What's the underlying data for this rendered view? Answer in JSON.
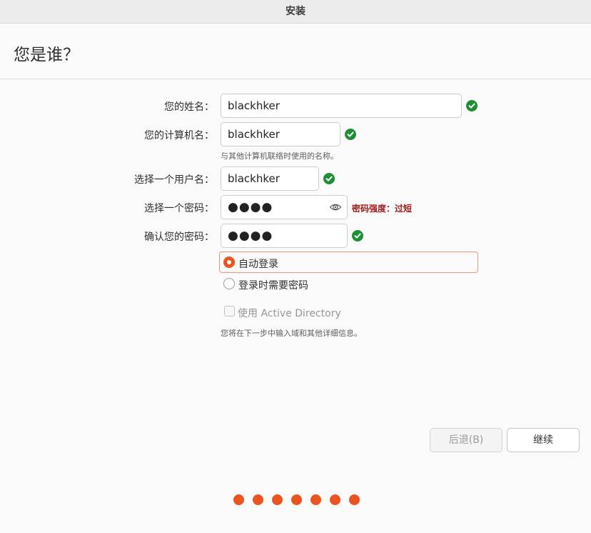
{
  "window": {
    "title": "安装"
  },
  "page": {
    "heading": "您是谁？"
  },
  "form": {
    "name": {
      "label": "您的姓名：",
      "value": "blackhker",
      "valid": true
    },
    "computer": {
      "label": "您的计算机名：",
      "value": "blackhker",
      "hint": "与其他计算机联络时使用的名称。",
      "valid": true
    },
    "username": {
      "label": "选择一个用户名：",
      "value": "blackhker",
      "valid": true
    },
    "password": {
      "label": "选择一个密码：",
      "masked": "●●●●",
      "strength": "密码强度：过短",
      "show_icon": "eye-icon"
    },
    "confirm": {
      "label": "确认您的密码：",
      "masked": "●●●●",
      "valid": true
    }
  },
  "login": {
    "options": [
      {
        "label": "自动登录",
        "selected": true
      },
      {
        "label": "登录时需要密码",
        "selected": false
      }
    ]
  },
  "active_directory": {
    "label": "使用 Active Directory",
    "checked": false,
    "enabled": false,
    "hint": "您将在下一步中输入域和其他详细信息。"
  },
  "buttons": {
    "back": "后退(B)",
    "continue": "继续"
  },
  "progress": {
    "steps": 7
  },
  "colors": {
    "accent": "#e95420",
    "valid": "#1f8f35",
    "warning": "#a01b1b"
  }
}
